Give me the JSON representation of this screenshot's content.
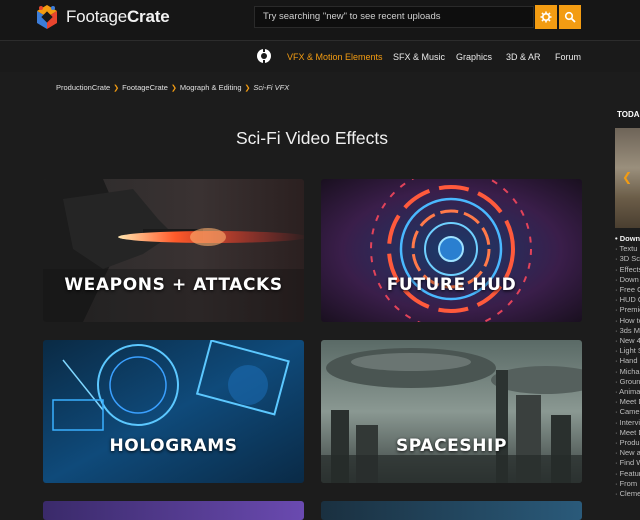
{
  "header": {
    "logo_text_light": "Footage",
    "logo_text_bold": "Crate",
    "search_placeholder": "Try searching \"new\" to see recent uploads",
    "settings_icon": "gear-icon",
    "search_icon": "search-icon",
    "accent": "#f39c12"
  },
  "nav": {
    "icon": "productioncrate-icon",
    "items": [
      "VFX & Motion Elements",
      "SFX & Music",
      "Graphics",
      "3D & AR",
      "Forum"
    ],
    "active_index": 0
  },
  "breadcrumb": [
    "ProductionCrate",
    "FootageCrate",
    "Mograph & Editing",
    "Sci-Fi VFX"
  ],
  "page_title": "Sci-Fi Video Effects",
  "tiles": [
    {
      "label": "WEAPONS + ATTACKS"
    },
    {
      "label": "FUTURE HUD"
    },
    {
      "label": "HOLOGRAMS"
    },
    {
      "label": "SPACESHIP"
    }
  ],
  "sidebar": {
    "heading": "TODA",
    "items": [
      "Down",
      "Textu",
      "3D Sc",
      "Effects",
      "Down",
      "Free C",
      "HUD C",
      "Premie",
      "How to",
      "3ds Ma",
      "New 4",
      "Light S",
      "Hand",
      "Micha",
      "Groun",
      "Anima",
      "Meet D",
      "Came",
      "Intervi",
      "Meet D",
      "Produ",
      "New a",
      "Find W",
      "Featur",
      "From",
      "Cleme"
    ]
  }
}
